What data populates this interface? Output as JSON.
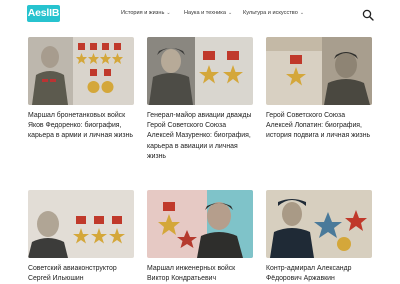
{
  "header": {
    "logo": "AeslIB",
    "nav": [
      {
        "label": "История и жизнь"
      },
      {
        "label": "Наука и техника"
      },
      {
        "label": "Культура и искусство"
      }
    ]
  },
  "cards": [
    {
      "title": "Маршал бронетанковых войск Яков Федоренко: биография, карьера в армии и личная жизнь"
    },
    {
      "title": "Генерал-майор авиации дважды Герой Советского Союза Алексей Мазуренко: биография, карьера в авиации и личная жизнь"
    },
    {
      "title": "Герой Советского Союза Алексей Лопатин: биография, история подвига и личная жизнь"
    },
    {
      "title": "Советский авиаконструктор Сергей Ильюшин"
    },
    {
      "title": "Маршал инженерных войск Виктор Кондратьевич"
    },
    {
      "title": "Контр-адмирал Александр Фёдорович Аржавкин"
    }
  ]
}
